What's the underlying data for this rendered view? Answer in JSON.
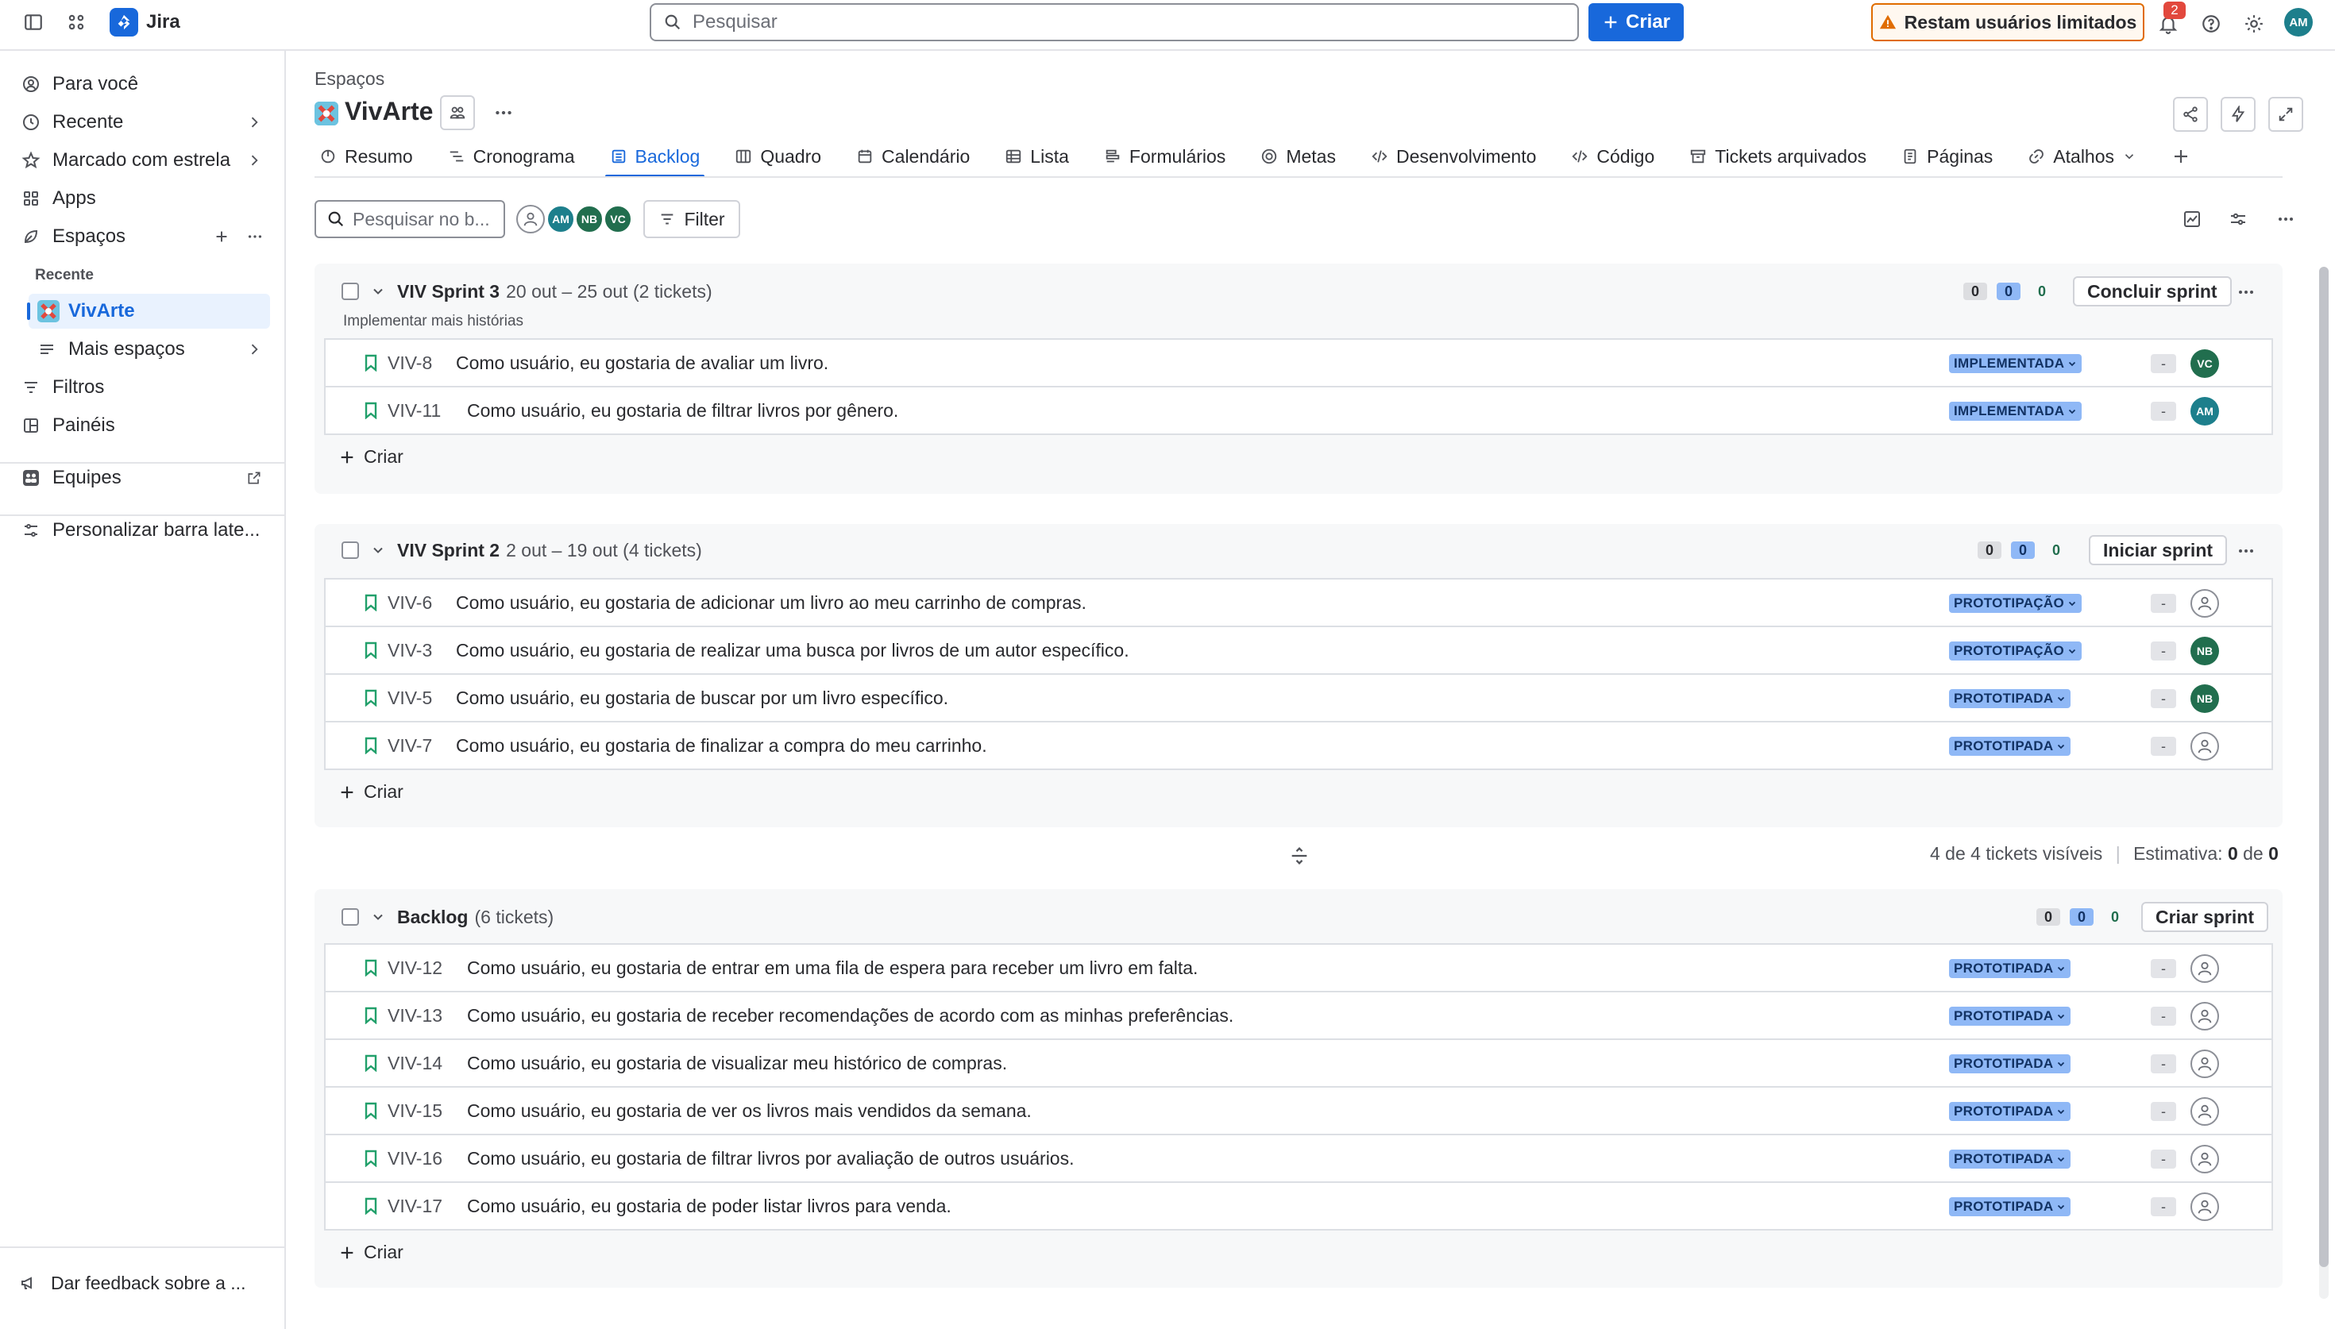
{
  "app": {
    "name": "Jira"
  },
  "search": {
    "placeholder": "Pesquisar"
  },
  "top": {
    "create_label": "Criar",
    "limited_label": "Restam usuários limitados",
    "notification_count": "2",
    "user_initials": "AM"
  },
  "sidebar": {
    "items": [
      {
        "label": "Para você",
        "icon": "user-circle-icon"
      },
      {
        "label": "Recente",
        "icon": "clock-icon"
      },
      {
        "label": "Marcado com estrela",
        "icon": "star-icon"
      },
      {
        "label": "Apps",
        "icon": "apps-icon"
      },
      {
        "label": "Espaços",
        "icon": "spaces-icon"
      }
    ],
    "section_recent": "Recente",
    "project": "VivArte",
    "more_spaces": "Mais espaços",
    "filters": "Filtros",
    "dashboards": "Painéis",
    "teams": "Equipes",
    "customize": "Personalizar barra late...",
    "feedback": "Dar feedback sobre a ..."
  },
  "header": {
    "breadcrumb": "Espaços",
    "title": "VivArte"
  },
  "tabs": [
    {
      "label": "Resumo",
      "icon": "summary-icon"
    },
    {
      "label": "Cronograma",
      "icon": "timeline-icon"
    },
    {
      "label": "Backlog",
      "icon": "backlog-icon",
      "active": true
    },
    {
      "label": "Quadro",
      "icon": "board-icon"
    },
    {
      "label": "Calendário",
      "icon": "calendar-icon"
    },
    {
      "label": "Lista",
      "icon": "list-icon"
    },
    {
      "label": "Formulários",
      "icon": "forms-icon"
    },
    {
      "label": "Metas",
      "icon": "goals-icon"
    },
    {
      "label": "Desenvolvimento",
      "icon": "code-icon"
    },
    {
      "label": "Código",
      "icon": "code-icon"
    },
    {
      "label": "Tickets arquivados",
      "icon": "archive-icon"
    },
    {
      "label": "Páginas",
      "icon": "pages-icon"
    },
    {
      "label": "Atalhos",
      "icon": "link-icon"
    }
  ],
  "toolbar": {
    "search_placeholder": "Pesquisar no b...",
    "filter_label": "Filter",
    "avatars": [
      {
        "initials": "AM",
        "color": "#1d7f8c"
      },
      {
        "initials": "NB",
        "color": "#216e4e"
      },
      {
        "initials": "VC",
        "color": "#216e4e"
      }
    ]
  },
  "colors": {
    "accent": "#1868db",
    "status_bg": "#8fb8f6",
    "story": "#22a06b",
    "warning": "#e06c00"
  },
  "sprints": [
    {
      "name": "VIV Sprint 3",
      "dates": "20 out – 25 out (2 tickets)",
      "goal": "Implementar mais histórias",
      "counts": [
        "0",
        "0",
        "0"
      ],
      "action": "Concluir sprint",
      "issues": [
        {
          "key": "VIV-8",
          "summary": "Como usuário, eu gostaria de avaliar um livro.",
          "status": "IMPLEMENTADA",
          "estimate": "-",
          "assignee": "VC",
          "assignee_color": "#216e4e"
        },
        {
          "key": "VIV-11",
          "summary": "Como usuário, eu gostaria de filtrar livros por gênero.",
          "status": "IMPLEMENTADA",
          "estimate": "-",
          "assignee": "AM",
          "assignee_color": "#1d7f8c"
        }
      ],
      "create": "Criar"
    },
    {
      "name": "VIV Sprint 2",
      "dates": "2 out – 19 out (4 tickets)",
      "goal": "",
      "counts": [
        "0",
        "0",
        "0"
      ],
      "action": "Iniciar sprint",
      "issues": [
        {
          "key": "VIV-6",
          "summary": "Como usuário, eu gostaria de adicionar um livro ao meu carrinho de compras.",
          "status": "PROTOTIPAÇÃO",
          "estimate": "-",
          "assignee": "",
          "assignee_color": ""
        },
        {
          "key": "VIV-3",
          "summary": "Como usuário, eu gostaria de realizar uma busca por livros de um autor específico.",
          "status": "PROTOTIPAÇÃO",
          "estimate": "-",
          "assignee": "NB",
          "assignee_color": "#216e4e"
        },
        {
          "key": "VIV-5",
          "summary": "Como usuário, eu gostaria de buscar por um livro específico.",
          "status": "PROTOTIPADA",
          "estimate": "-",
          "assignee": "NB",
          "assignee_color": "#216e4e"
        },
        {
          "key": "VIV-7",
          "summary": "Como usuário, eu gostaria de finalizar a compra do meu carrinho.",
          "status": "PROTOTIPADA",
          "estimate": "-",
          "assignee": "",
          "assignee_color": ""
        }
      ],
      "create": "Criar"
    }
  ],
  "visible_stats": {
    "text": "4 de 4 tickets visíveis",
    "estimate_label": "Estimativa:",
    "estimate_value": "0",
    "of": "de",
    "total": "0"
  },
  "backlog": {
    "name": "Backlog",
    "count": "(6 tickets)",
    "counts": [
      "0",
      "0",
      "0"
    ],
    "action": "Criar sprint",
    "issues": [
      {
        "key": "VIV-12",
        "summary": "Como usuário, eu gostaria de entrar em uma fila de espera para receber um livro em falta.",
        "status": "PROTOTIPADA",
        "estimate": "-"
      },
      {
        "key": "VIV-13",
        "summary": "Como usuário, eu gostaria de receber recomendações de acordo com as minhas preferências.",
        "status": "PROTOTIPADA",
        "estimate": "-"
      },
      {
        "key": "VIV-14",
        "summary": "Como usuário, eu gostaria de visualizar meu histórico de compras.",
        "status": "PROTOTIPADA",
        "estimate": "-"
      },
      {
        "key": "VIV-15",
        "summary": "Como usuário, eu gostaria de ver os livros mais vendidos da semana.",
        "status": "PROTOTIPADA",
        "estimate": "-"
      },
      {
        "key": "VIV-16",
        "summary": "Como usuário, eu gostaria de filtrar livros por avaliação de outros usuários.",
        "status": "PROTOTIPADA",
        "estimate": "-"
      },
      {
        "key": "VIV-17",
        "summary": "Como usuário, eu gostaria de poder listar livros para venda.",
        "status": "PROTOTIPADA",
        "estimate": "-"
      }
    ],
    "create": "Criar"
  }
}
